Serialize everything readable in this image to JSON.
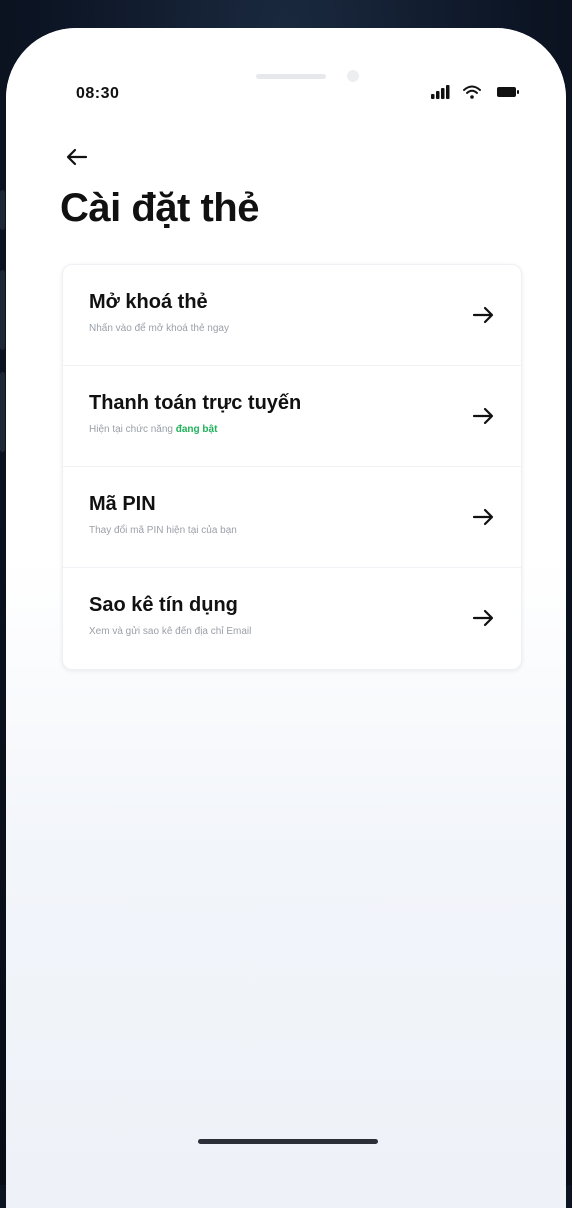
{
  "status_bar": {
    "time": "08:30",
    "icons": [
      "signal-icon",
      "wifi-icon",
      "battery-icon"
    ]
  },
  "header": {
    "back_icon": "arrow-left-icon",
    "title": "Cài đặt thẻ"
  },
  "settings": {
    "items": [
      {
        "title": "Mở khoá thẻ",
        "subtitle": "Nhấn vào để mở khoá thẻ ngay",
        "subtitle_highlight": "",
        "icon": "arrow-right-icon"
      },
      {
        "title": "Thanh toán trực tuyến",
        "subtitle": "Hiện tại chức năng ",
        "subtitle_highlight": "đang bật",
        "icon": "arrow-right-icon"
      },
      {
        "title": "Mã PIN",
        "subtitle": "Thay đổi mã PIN hiện tại của bạn",
        "subtitle_highlight": "",
        "icon": "arrow-right-icon"
      },
      {
        "title": "Sao kê tín dụng",
        "subtitle": "Xem và gửi sao kê đến địa chỉ Email",
        "subtitle_highlight": "",
        "icon": "arrow-right-icon"
      }
    ]
  },
  "colors": {
    "highlight": "#1fb25a",
    "text_primary": "#111111",
    "text_secondary": "#9aa0a8"
  }
}
